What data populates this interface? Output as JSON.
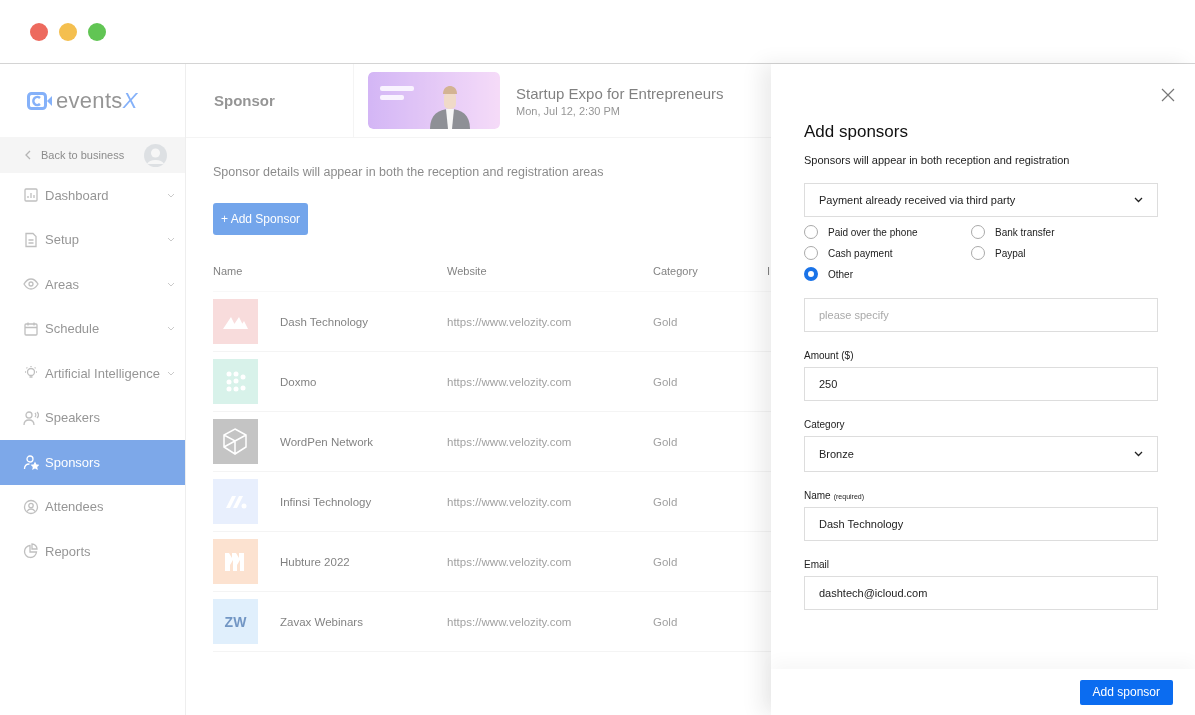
{
  "sidebar": {
    "logo": {
      "text": "events",
      "accent": "X"
    },
    "back": {
      "label": "Back to business"
    },
    "items": [
      {
        "label": "Dashboard",
        "kind": "chart",
        "expandable": true,
        "selected": false
      },
      {
        "label": "Setup",
        "kind": "doc",
        "expandable": true,
        "selected": false
      },
      {
        "label": "Areas",
        "kind": "eye",
        "expandable": true,
        "selected": false
      },
      {
        "label": "Schedule",
        "kind": "calendar",
        "expandable": true,
        "selected": false
      },
      {
        "label": "Artificial Intelligence",
        "kind": "bulb",
        "expandable": true,
        "selected": false
      },
      {
        "label": "Speakers",
        "kind": "speaker",
        "expandable": false,
        "selected": false
      },
      {
        "label": "Sponsors",
        "kind": "sponsor",
        "expandable": false,
        "selected": true
      },
      {
        "label": "Attendees",
        "kind": "person",
        "expandable": false,
        "selected": false
      },
      {
        "label": "Reports",
        "kind": "pie",
        "expandable": false,
        "selected": false
      }
    ]
  },
  "header": {
    "title": "Sponsor",
    "event": {
      "title": "Startup Expo for Entrepreneurs",
      "date": "Mon, Jul 12, 2:30 PM"
    }
  },
  "description": "Sponsor details will appear in both the reception and registration areas",
  "add_button": "+ Add Sponsor",
  "table": {
    "columns": [
      "Name",
      "Website",
      "Category",
      "I"
    ],
    "rows": [
      {
        "name": "Dash Technology",
        "website": "https://www.velozity.com",
        "category": "Gold",
        "logo": {
          "kind": "mountains",
          "color": "#f8dcdc"
        }
      },
      {
        "name": "Doxmo",
        "website": "https://www.velozity.com",
        "category": "Gold",
        "logo": {
          "kind": "dots",
          "color": "#d8f2ea"
        }
      },
      {
        "name": "WordPen Network",
        "website": "https://www.velozity.com",
        "category": "Gold",
        "logo": {
          "kind": "polygon",
          "color": "#c4c4c4"
        }
      },
      {
        "name": "Infinsi Technology",
        "website": "https://www.velozity.com",
        "category": "Gold",
        "logo": {
          "kind": "slashes",
          "color": "#e8effd"
        }
      },
      {
        "name": "Hubture 2022",
        "website": "https://www.velozity.com",
        "category": "Gold",
        "logo": {
          "kind": "bars",
          "color": "#fce2d0"
        }
      },
      {
        "name": "Zavax Webinars",
        "website": "https://www.velozity.com",
        "category": "Gold",
        "logo": {
          "kind": "letters",
          "color": "#e0effc",
          "text": "ZW"
        }
      }
    ]
  },
  "drawer": {
    "title": "Add sponsors",
    "subtitle": "Sponsors will appear in both reception and registration",
    "payment_select": {
      "value": "Payment already received via third party"
    },
    "payment_methods": [
      {
        "label": "Paid over the phone",
        "selected": false
      },
      {
        "label": "Bank transfer",
        "selected": false
      },
      {
        "label": "Cash payment",
        "selected": false
      },
      {
        "label": "Paypal",
        "selected": false
      },
      {
        "label": "Other",
        "selected": true
      }
    ],
    "specify": {
      "placeholder": "please specify"
    },
    "fields": [
      {
        "label": "Amount ($)",
        "kind": "input",
        "value": "250"
      },
      {
        "label": "Category",
        "kind": "select",
        "value": "Bronze"
      },
      {
        "label": "Name",
        "hint": "(required)",
        "kind": "input",
        "value": "Dash Technology"
      },
      {
        "label": "Email",
        "kind": "input",
        "value": "dashtech@icloud.com"
      }
    ],
    "submit": "Add sponsor"
  }
}
